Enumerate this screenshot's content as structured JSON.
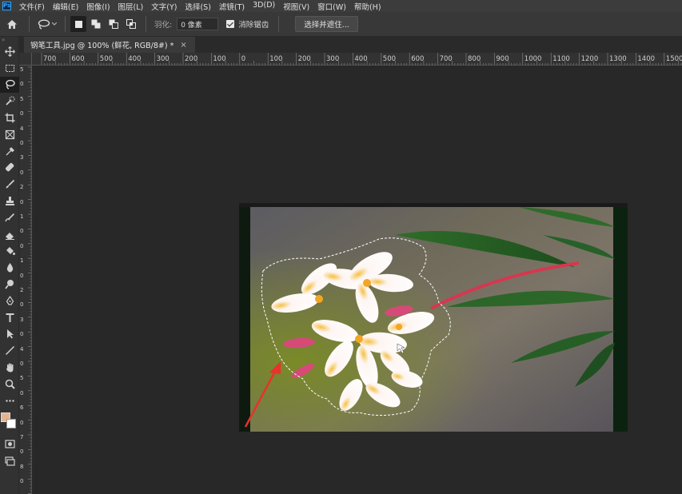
{
  "app": {
    "logo_text": "Ps"
  },
  "menu": [
    {
      "label": "文件(F)"
    },
    {
      "label": "编辑(E)"
    },
    {
      "label": "图像(I)"
    },
    {
      "label": "图层(L)"
    },
    {
      "label": "文字(Y)"
    },
    {
      "label": "选择(S)"
    },
    {
      "label": "滤镜(T)"
    },
    {
      "label": "3D(D)"
    },
    {
      "label": "视图(V)"
    },
    {
      "label": "窗口(W)"
    },
    {
      "label": "帮助(H)"
    }
  ],
  "options": {
    "feather_label": "羽化:",
    "feather_value": "0 像素",
    "antialias_label": "消除锯齿",
    "antialias_checked": true,
    "select_mask_label": "选择并遮住..."
  },
  "document": {
    "tab_title": "钢笔工具.jpg @ 100% (鲜花, RGB/8#) *",
    "close_glyph": "×"
  },
  "ruler": {
    "h_labels": [
      "700",
      "600",
      "500",
      "400",
      "300",
      "200",
      "100",
      "0",
      "100",
      "200",
      "300",
      "400",
      "500",
      "600",
      "700",
      "800",
      "900",
      "1000",
      "1100",
      "1200",
      "1300",
      "1400",
      "1500"
    ],
    "v_labels": [
      "5",
      "0",
      "5",
      "0",
      "4",
      "0",
      "3",
      "0",
      "2",
      "0",
      "1",
      "0",
      "0",
      "1",
      "0",
      "2",
      "0",
      "3",
      "0",
      "4",
      "0",
      "5",
      "0",
      "6",
      "0",
      "7",
      "0",
      "8",
      "0"
    ]
  },
  "tools": [
    {
      "name": "move-tool-icon"
    },
    {
      "name": "marquee-tool-icon"
    },
    {
      "name": "lasso-tool-icon",
      "active": true
    },
    {
      "name": "quick-select-tool-icon"
    },
    {
      "name": "crop-tool-icon"
    },
    {
      "name": "frame-tool-icon"
    },
    {
      "name": "eyedropper-tool-icon"
    },
    {
      "name": "healing-brush-tool-icon"
    },
    {
      "name": "brush-tool-icon"
    },
    {
      "name": "clone-stamp-tool-icon"
    },
    {
      "name": "history-brush-tool-icon"
    },
    {
      "name": "eraser-tool-icon"
    },
    {
      "name": "paint-bucket-tool-icon"
    },
    {
      "name": "blur-tool-icon"
    },
    {
      "name": "dodge-tool-icon"
    },
    {
      "name": "pen-tool-icon"
    },
    {
      "name": "type-tool-icon"
    },
    {
      "name": "path-select-tool-icon"
    },
    {
      "name": "line-tool-icon"
    },
    {
      "name": "hand-tool-icon"
    },
    {
      "name": "zoom-tool-icon"
    },
    {
      "name": "more-tools-icon"
    }
  ],
  "colors": {
    "foreground": "#e4b491",
    "background": "#ffffff",
    "accent": "#31a8ff",
    "annotation_arrow": "#e8322b"
  }
}
